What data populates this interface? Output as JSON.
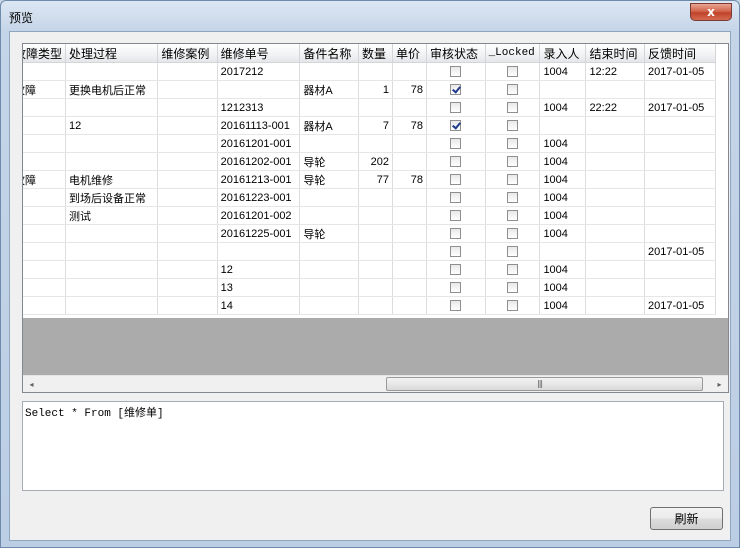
{
  "window": {
    "title": "预览",
    "close_glyph": "x"
  },
  "grid": {
    "columns": [
      "故障类型",
      "处理过程",
      "维修案例",
      "维修单号",
      "备件名称",
      "数量",
      "单价",
      "审核状态",
      "_Locked",
      "录入人",
      "结束时间",
      "反馈时间"
    ],
    "rows": [
      {
        "c0": "",
        "c1": "",
        "c2": "",
        "c3": "2017212",
        "c4": "",
        "c5": "",
        "c6": "",
        "audit": false,
        "locked": false,
        "c9": "1004",
        "c10": "12:22",
        "c11": "2017-01-05"
      },
      {
        "c0": "故障",
        "c1": "更换电机后正常",
        "c2": "",
        "c3": "",
        "c4": "器材A",
        "c5": "1",
        "c6": "78",
        "audit": true,
        "locked": false,
        "c9": "",
        "c10": "",
        "c11": ""
      },
      {
        "c0": "",
        "c1": "",
        "c2": "",
        "c3": "1212313",
        "c4": "",
        "c5": "",
        "c6": "",
        "audit": false,
        "locked": false,
        "c9": "1004",
        "c10": "22:22",
        "c11": "2017-01-05"
      },
      {
        "c0": "",
        "c1": "12",
        "c2": "",
        "c3": "20161113-001",
        "c4": "器材A",
        "c5": "7",
        "c6": "78",
        "audit": true,
        "locked": false,
        "c9": "",
        "c10": "",
        "c11": ""
      },
      {
        "c0": "",
        "c1": "",
        "c2": "",
        "c3": "20161201-001",
        "c4": "",
        "c5": "",
        "c6": "",
        "audit": false,
        "locked": false,
        "c9": "1004",
        "c10": "",
        "c11": ""
      },
      {
        "c0": "",
        "c1": "",
        "c2": "",
        "c3": "20161202-001",
        "c4": "导轮",
        "c5": "202",
        "c6": "",
        "audit": false,
        "locked": false,
        "c9": "1004",
        "c10": "",
        "c11": ""
      },
      {
        "c0": "故障",
        "c1": "电机维修",
        "c2": "",
        "c3": "20161213-001",
        "c4": "导轮",
        "c5": "77",
        "c6": "78",
        "audit": false,
        "locked": false,
        "c9": "1004",
        "c10": "",
        "c11": ""
      },
      {
        "c0": "",
        "c1": "到场后设备正常",
        "c2": "",
        "c3": "20161223-001",
        "c4": "",
        "c5": "",
        "c6": "",
        "audit": false,
        "locked": false,
        "c9": "1004",
        "c10": "",
        "c11": ""
      },
      {
        "c0": "",
        "c1": "测试",
        "c2": "",
        "c3": "20161201-002",
        "c4": "",
        "c5": "",
        "c6": "",
        "audit": false,
        "locked": false,
        "c9": "1004",
        "c10": "",
        "c11": ""
      },
      {
        "c0": "",
        "c1": "",
        "c2": "",
        "c3": "20161225-001",
        "c4": "导轮",
        "c5": "",
        "c6": "",
        "audit": false,
        "locked": false,
        "c9": "1004",
        "c10": "",
        "c11": ""
      },
      {
        "c0": "",
        "c1": "",
        "c2": "",
        "c3": "",
        "c4": "",
        "c5": "",
        "c6": "",
        "audit": false,
        "locked": false,
        "c9": "",
        "c10": "",
        "c11": "2017-01-05"
      },
      {
        "c0": "",
        "c1": "",
        "c2": "",
        "c3": "12",
        "c4": "",
        "c5": "",
        "c6": "",
        "audit": false,
        "locked": false,
        "c9": "1004",
        "c10": "",
        "c11": ""
      },
      {
        "c0": "",
        "c1": "",
        "c2": "",
        "c3": "13",
        "c4": "",
        "c5": "",
        "c6": "",
        "audit": false,
        "locked": false,
        "c9": "1004",
        "c10": "",
        "c11": ""
      },
      {
        "c0": "",
        "c1": "",
        "c2": "",
        "c3": "14",
        "c4": "",
        "c5": "",
        "c6": "",
        "audit": false,
        "locked": false,
        "c9": "1004",
        "c10": "",
        "c11": "2017-01-05"
      }
    ]
  },
  "scrollbar": {
    "left_glyph": "◂",
    "right_glyph": "▸",
    "grip": "|||"
  },
  "sql": {
    "text": "Select * From [维修单]"
  },
  "buttons": {
    "refresh": "刷新"
  }
}
